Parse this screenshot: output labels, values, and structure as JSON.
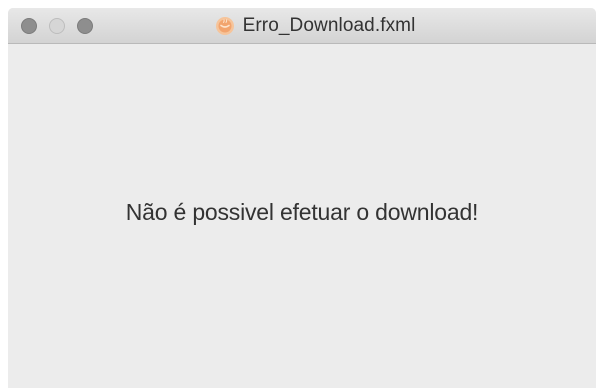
{
  "window": {
    "title": "Erro_Download.fxml",
    "app_icon": "java-coffee-icon"
  },
  "content": {
    "message": "Não é possivel efetuar o download!"
  },
  "colors": {
    "titlebar": "#dcdcdc",
    "background": "#ececec",
    "text": "#333333",
    "icon_accent": "#f0a070"
  }
}
